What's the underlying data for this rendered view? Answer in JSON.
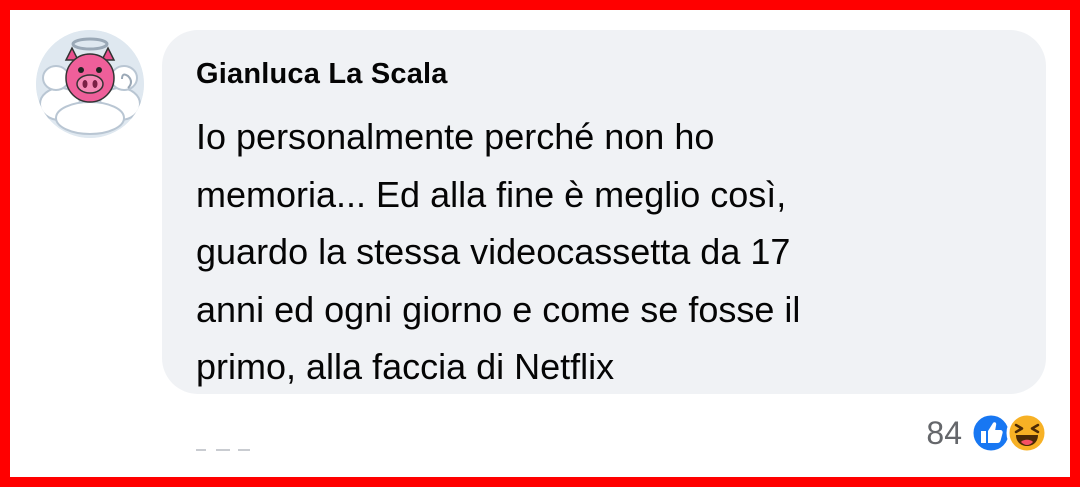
{
  "comment": {
    "author": "Gianluca La Scala",
    "text_lines": [
      "Io personalmente perché non ho",
      "memoria... Ed alla fine è meglio così,",
      "guardo la stessa videocassetta da 17",
      "anni ed ogni giorno e come se fosse il",
      "primo, alla faccia di Netflix"
    ]
  },
  "reactions": {
    "count": "84",
    "icons": [
      "like-icon",
      "haha-icon"
    ]
  },
  "colors": {
    "frame": "#ff0000",
    "bubble": "#f0f2f5",
    "like": "#1877f2",
    "haha": "#f7b125",
    "count_text": "#65676b"
  }
}
